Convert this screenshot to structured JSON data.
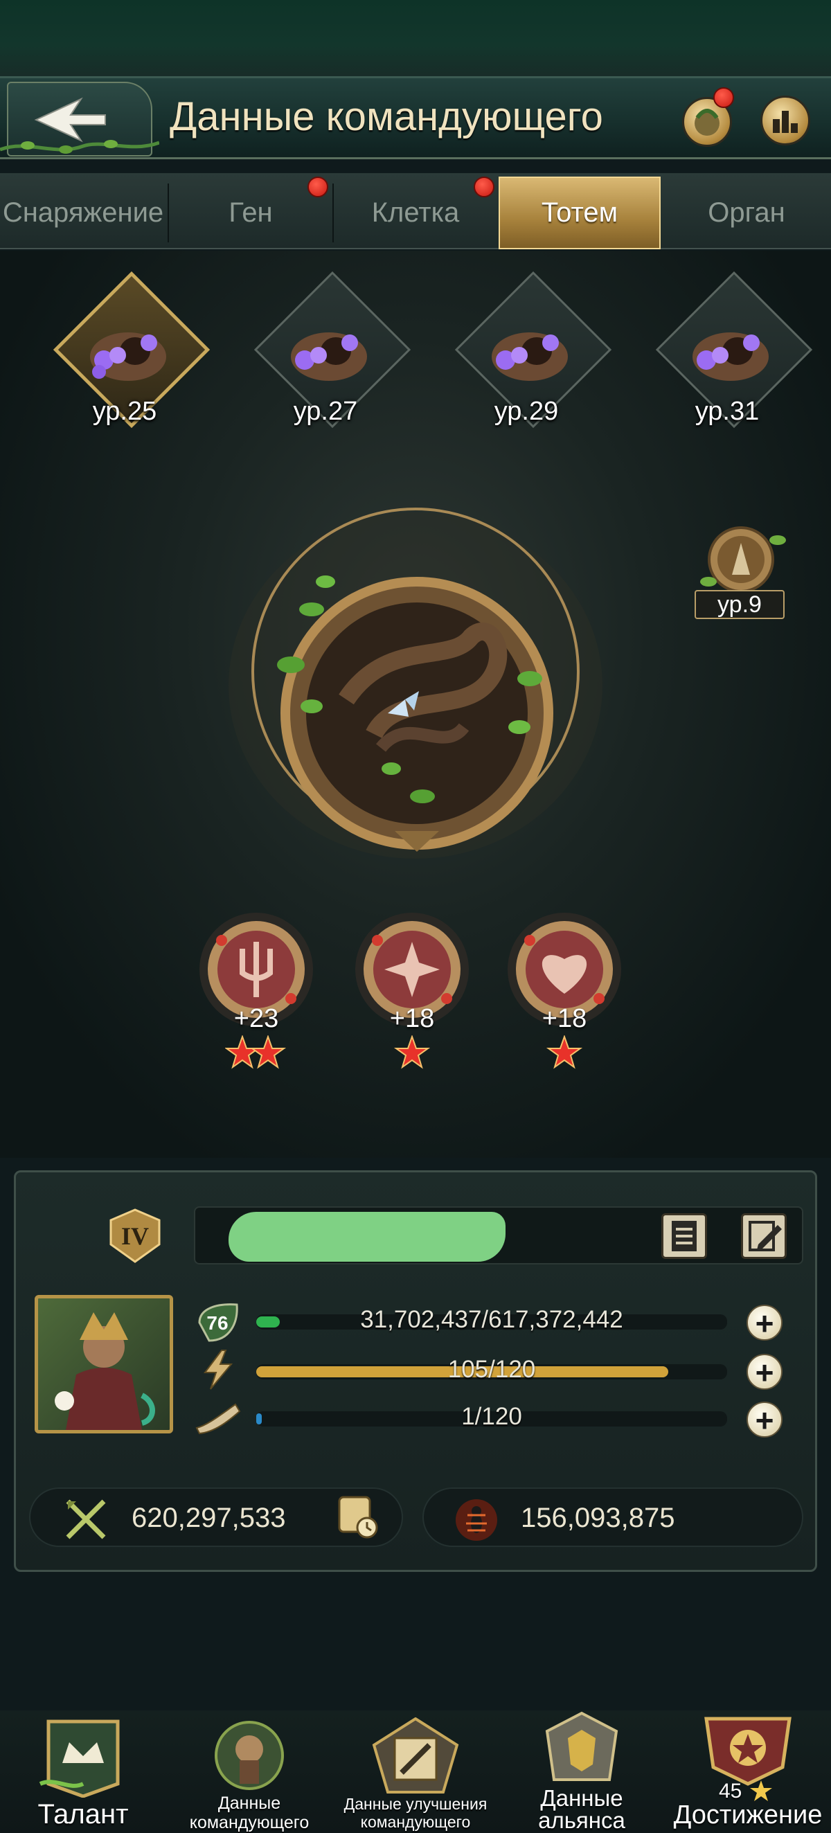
{
  "header": {
    "title": "Данные командующего",
    "back_icon": "back-arrow-icon",
    "right_buttons": [
      {
        "icon": "bag-icon",
        "has_notification": true
      },
      {
        "icon": "ranking-icon",
        "has_notification": false
      }
    ]
  },
  "tabs": [
    {
      "label": "Снаряжение",
      "active": false,
      "has_notification": false
    },
    {
      "label": "Ген",
      "active": false,
      "has_notification": true
    },
    {
      "label": "Клетка",
      "active": false,
      "has_notification": true
    },
    {
      "label": "Тотем",
      "active": true,
      "has_notification": false
    },
    {
      "label": "Орган",
      "active": false,
      "has_notification": false
    }
  ],
  "totem_levels": [
    {
      "label": "ур.25",
      "selected": true
    },
    {
      "label": "ур.27",
      "selected": false
    },
    {
      "label": "ур.29",
      "selected": false
    },
    {
      "label": "ур.31",
      "selected": false
    }
  ],
  "side_badge": {
    "label": "ур.9"
  },
  "totem_stats": [
    {
      "icon": "trident-rune-icon",
      "value": "+23",
      "stars": 2
    },
    {
      "icon": "spark-rune-icon",
      "value": "+18",
      "stars": 1
    },
    {
      "icon": "heart-rune-icon",
      "value": "+18",
      "stars": 1
    }
  ],
  "commander": {
    "rank_badge": "IV",
    "level": "76",
    "exp": {
      "text": "31,702,437/617,372,442",
      "fraction": 0.05
    },
    "energy": {
      "text": "105/120",
      "fraction": 0.875
    },
    "horn": {
      "text": "1/120",
      "fraction": 0.01
    },
    "power": "620,297,533",
    "kills": "156,093,875"
  },
  "nav": [
    {
      "label": "Талант",
      "icon": "talent-crown-icon"
    },
    {
      "label": "Данные командующего",
      "line1": "Данные",
      "line2": "командующего",
      "icon": "commander-data-icon"
    },
    {
      "label": "Данные улучшения командующего",
      "line1": "Данные улучшения",
      "line2": "командующего",
      "icon": "upgrade-scroll-icon"
    },
    {
      "label": "Данные альянса",
      "line1": "Данные",
      "line2": "альянса",
      "icon": "alliance-crest-icon"
    },
    {
      "label": "Достижение",
      "count": "45",
      "icon": "achievement-trophy-icon"
    }
  ],
  "colors": {
    "accent_gold": "#c9a95c",
    "notify_red": "#e0261b",
    "exp_green": "#2fb34f",
    "energy_gold": "#d1a23a"
  }
}
